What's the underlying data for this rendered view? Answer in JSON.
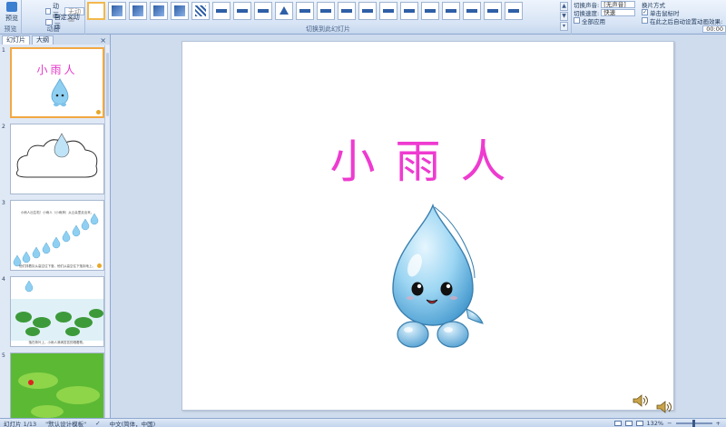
{
  "ribbon": {
    "preview_label": "预览",
    "group_preview": "预览",
    "group_animation": "动画",
    "group_transitions": "切换到此幻灯片",
    "anim_label": "动画:",
    "anim_value": "无动画",
    "custom_anim": "自定义动画",
    "transition_thumbs": [
      "none",
      "fade",
      "fade",
      "fade",
      "fade",
      "hatch",
      "bar",
      "bar",
      "bar",
      "arrow",
      "bar",
      "bar",
      "bar",
      "bar",
      "bar",
      "bar",
      "bar",
      "bar",
      "bar",
      "bar",
      "bar"
    ],
    "sound_label": "切换声音:",
    "sound_value": "[无声音]",
    "speed_label": "切换速度:",
    "speed_value": "快速",
    "apply_all": "全部应用",
    "advance_title": "换片方式",
    "on_click": "单击鼠标时",
    "after_label": "在此之后自动设置动画效果:",
    "after_time": "00:00"
  },
  "panel": {
    "tab_slides": "幻灯片",
    "tab_outline": "大纲",
    "close": "×",
    "slides": [
      {
        "num": "1",
        "title": "小雨人",
        "caption": ""
      },
      {
        "num": "2",
        "title": "",
        "caption": ""
      },
      {
        "num": "",
        "title": "",
        "caption": "小雨人出生啦！小雨人（小雨滴）从云朵里走出来。"
      },
      {
        "num": "3",
        "title": "",
        "caption": "他们排着队从高空往下落，他们从高空往下落到地上。"
      },
      {
        "num": "4",
        "title": "",
        "caption": "落在荷叶上，小雨人滴滴答答的唱着歌。"
      },
      {
        "num": "5",
        "title": "",
        "caption": ""
      }
    ]
  },
  "slide": {
    "title": "小雨人"
  },
  "status": {
    "slide_count": "幻灯片 1/13",
    "theme": "\"默认设计模板\"",
    "language": "中文(简体，中国)",
    "zoom": "132%"
  }
}
